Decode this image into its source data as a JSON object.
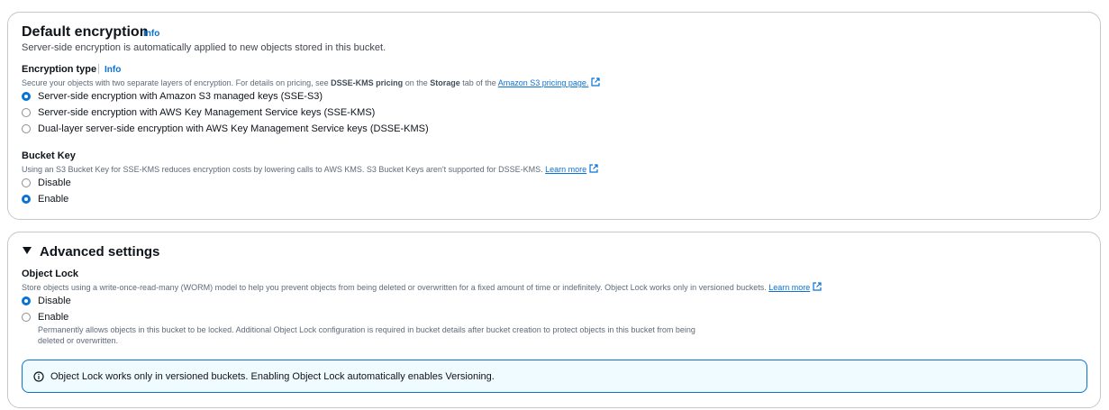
{
  "encryption": {
    "title": "Default encryption",
    "info": "Info",
    "description": "Server-side encryption is automatically applied to new objects stored in this bucket.",
    "type_label": "Encryption type",
    "type_info": "Info",
    "type_desc_1": "Secure your objects with two separate layers of encryption. For details on pricing, see ",
    "type_desc_bold1": "DSSE-KMS pricing",
    "type_desc_2": " on the ",
    "type_desc_bold2": "Storage",
    "type_desc_3": " tab of the ",
    "type_desc_link": "Amazon S3 pricing page.",
    "options": [
      {
        "label": "Server-side encryption with Amazon S3 managed keys (SSE-S3)",
        "checked": true
      },
      {
        "label": "Server-side encryption with AWS Key Management Service keys (SSE-KMS)",
        "checked": false
      },
      {
        "label": "Dual-layer server-side encryption with AWS Key Management Service keys (DSSE-KMS)",
        "checked": false
      }
    ],
    "bucket_key_label": "Bucket Key",
    "bucket_key_desc": "Using an S3 Bucket Key for SSE-KMS reduces encryption costs by lowering calls to AWS KMS. S3 Bucket Keys aren't supported for DSSE-KMS. ",
    "bucket_key_link": "Learn more",
    "bucket_key_options": [
      {
        "label": "Disable",
        "checked": false
      },
      {
        "label": "Enable",
        "checked": true
      }
    ]
  },
  "advanced": {
    "title": "Advanced settings",
    "object_lock_label": "Object Lock",
    "object_lock_desc": "Store objects using a write-once-read-many (WORM) model to help you prevent objects from being deleted or overwritten for a fixed amount of time or indefinitely. Object Lock works only in versioned buckets. ",
    "object_lock_link": "Learn more",
    "options": [
      {
        "label": "Disable",
        "checked": true
      },
      {
        "label": "Enable",
        "checked": false
      }
    ],
    "enable_help_1": "Permanently allows objects in this bucket to be locked. Additional Object Lock configuration is required in bucket details after bucket creation to protect objects in this bucket from being",
    "enable_help_2": "deleted or overwritten.",
    "alert_text": "Object Lock works only in versioned buckets. Enabling Object Lock automatically enables Versioning."
  },
  "colors": {
    "accent": "#0972d3",
    "alert_bg": "#f0fbff",
    "border": "#c6c6cd"
  },
  "icons": {
    "external": "external-link-icon",
    "info": "info-circle-icon",
    "caret": "caret-down-icon"
  }
}
